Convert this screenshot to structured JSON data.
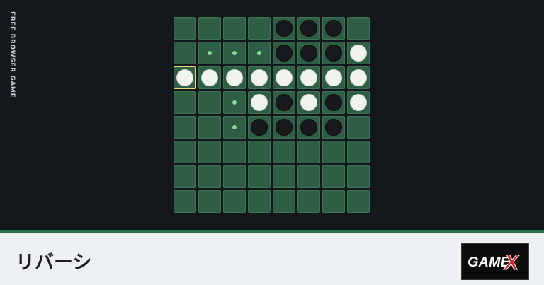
{
  "side_label": "FREE BROWSER GAME",
  "title": "リバーシ",
  "logo": {
    "text": "GAME",
    "accent": "X"
  },
  "colors": {
    "background": "#14171c",
    "cell": "#2e5e43",
    "cell_border": "#3f7557",
    "black_disc": "#17191c",
    "white_disc": "#f1f3ee",
    "hint_dot": "#8fd59d",
    "selected_outline": "#e5dc77",
    "bar_bg": "#eef1f3",
    "bar_accent": "#2c7049",
    "logo_red": "#e01b24"
  },
  "board": {
    "legend": {
      "B": "black disc",
      "W": "white disc",
      "H": "valid move hint",
      "E": "empty"
    },
    "selected": [
      2,
      0
    ],
    "rows": [
      "EEEEBBBE",
      "EHHHBBBW",
      "WWWWWWWW",
      "EEHWBWBW",
      "EEHBBBBE",
      "EEEEEEEE",
      "EEEEEEEE",
      "EEEEEEEE"
    ]
  }
}
